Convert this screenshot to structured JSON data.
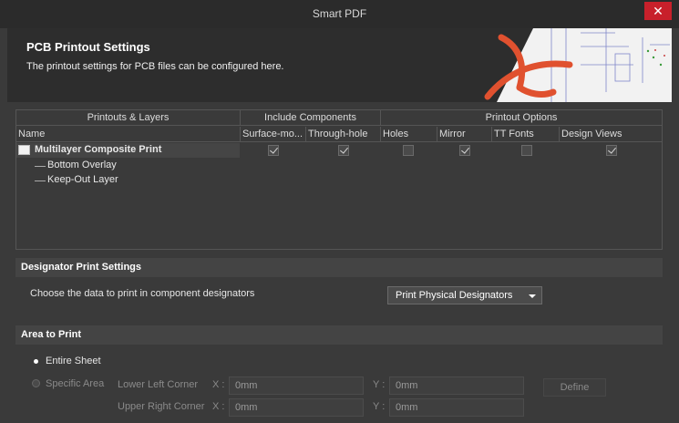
{
  "window": {
    "title": "Smart PDF",
    "close_label": "✕"
  },
  "header": {
    "title": "PCB Printout Settings",
    "subtitle": "The printout settings for PCB files can be configured here."
  },
  "table": {
    "groups": [
      "Printouts & Layers",
      "Include Components",
      "Printout Options"
    ],
    "columns": [
      "Name",
      "Surface-mo...",
      "Through-hole",
      "Holes",
      "Mirror",
      "TT Fonts",
      "Design Views"
    ],
    "rows": [
      {
        "name": "Multilayer Composite Print",
        "checks": [
          true,
          true,
          false,
          true,
          false,
          true
        ]
      },
      {
        "name": "Bottom Overlay"
      },
      {
        "name": "Keep-Out Layer"
      }
    ]
  },
  "designator": {
    "section_title": "Designator Print Settings",
    "prompt": "Choose the data to print in component designators",
    "dropdown_value": "Print Physical Designators"
  },
  "area": {
    "section_title": "Area to Print",
    "entire_sheet_label": "Entire Sheet",
    "specific_area_label": "Specific Area",
    "lower_left_label": "Lower Left Corner",
    "upper_right_label": "Upper Right Corner",
    "x_label": "X :",
    "y_label": "Y :",
    "lower_left_x": "0mm",
    "lower_left_y": "0mm",
    "upper_right_x": "0mm",
    "upper_right_y": "0mm",
    "define_label": "Define"
  }
}
